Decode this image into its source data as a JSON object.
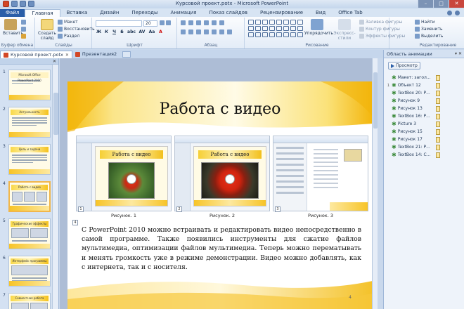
{
  "window": {
    "title": "Курсовой проект.potx - Microsoft PowerPoint",
    "controls": [
      "–",
      "□",
      "✕"
    ]
  },
  "ribbon": {
    "tabs": [
      "Файл",
      "Главная",
      "Вставка",
      "Дизайн",
      "Переходы",
      "Анимация",
      "Показ слайдов",
      "Рецензирование",
      "Вид",
      "Office Tab"
    ],
    "clipboard": {
      "paste": "Вставить",
      "label": "Буфер обмена"
    },
    "slides": {
      "new_slide": "Создать слайд",
      "layout": "Макет",
      "reset": "Восстановить",
      "section": "Раздел",
      "label": "Слайды"
    },
    "font": {
      "name": "",
      "size": "20",
      "bold": "Ж",
      "italic": "К",
      "underline": "Ч",
      "strike": "S",
      "shadow": "abc",
      "spacing": "AV",
      "case": "Aa",
      "color": "A",
      "label": "Шрифт"
    },
    "paragraph": {
      "label": "Абзац"
    },
    "drawing": {
      "arrange": "Упорядочить",
      "quick_styles": "Экспресс-стили",
      "fill": "Заливка фигуры",
      "outline": "Контур фигуры",
      "effects": "Эффекты фигуры",
      "label": "Рисование"
    },
    "editing": {
      "find": "Найти",
      "replace": "Заменить",
      "select": "Выделить",
      "label": "Редактирование"
    }
  },
  "doc_tabs": [
    {
      "label": "Курсовой проект.potx",
      "active": true
    },
    {
      "label": "Презентация2",
      "active": false
    }
  ],
  "thumbnails": [
    {
      "num": "1",
      "title": "Microsoft Office PowerPoint 2010"
    },
    {
      "num": "2",
      "title": "Актуальность"
    },
    {
      "num": "3",
      "title": "Цель и задачи"
    },
    {
      "num": "4",
      "title": "Работа с видео"
    },
    {
      "num": "5",
      "title": "Графические эффекты"
    },
    {
      "num": "6",
      "title": "Интерфейс программы"
    },
    {
      "num": "7",
      "title": "Совместная работа"
    }
  ],
  "selected_slide_index": 4,
  "slide": {
    "title": "Работа с видео",
    "figure_title": "Работа с видео",
    "figures": [
      {
        "num": "1",
        "caption": "Рисунок. 1"
      },
      {
        "num": "2",
        "caption": "Рисунок. 2"
      },
      {
        "num": "3",
        "caption": "Рисунок. 3"
      }
    ],
    "body_num": "4",
    "body": "С PowerPoint 2010 можно встраивать     и редактировать видео непосредственно в самой программе. Также появились инструменты для сжатие файлов мультимедиа, оптимизации файлов мультимедиа. Теперь можно перематывать и менять громкость уже в режиме демонстрации. Видео можно добавлять, как с интернета, так и с носителя.",
    "page_number": "4"
  },
  "animation_pane": {
    "title": "Область анимации",
    "preview": "Просмотр",
    "items": [
      {
        "idx": "",
        "label": "Макет: загол..."
      },
      {
        "idx": "1",
        "label": "Объект 12"
      },
      {
        "idx": "",
        "label": "TextBox 20: Р..."
      },
      {
        "idx": "",
        "label": "Рисунок 9"
      },
      {
        "idx": "",
        "label": "Рисунок 13"
      },
      {
        "idx": "",
        "label": "TextBox 16: Р..."
      },
      {
        "idx": "",
        "label": "Picture 3"
      },
      {
        "idx": "",
        "label": "Рисунок 15"
      },
      {
        "idx": "",
        "label": "Рисунок 17"
      },
      {
        "idx": "",
        "label": "TextBox 21: Р..."
      },
      {
        "idx": "",
        "label": "TextBox 14: С..."
      }
    ]
  },
  "colors": {
    "file_tab": "#2a5ea8",
    "accent_yellow": "#f7c428",
    "ribbon_bg": "#e3ecf7"
  }
}
